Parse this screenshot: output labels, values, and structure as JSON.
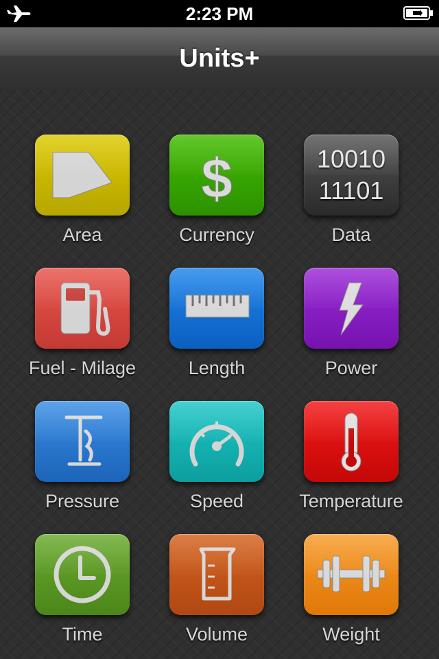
{
  "status_bar": {
    "time": "2:23 PM",
    "left_icon": "airplane-icon",
    "right_icon": "battery-charging-icon"
  },
  "nav": {
    "title": "Units+"
  },
  "tiles": [
    {
      "label": "Area",
      "color": "#c9b800",
      "icon": "area-shape-icon"
    },
    {
      "label": "Currency",
      "color": "#35a800",
      "icon": "dollar-icon"
    },
    {
      "label": "Data",
      "color": "#3c3c3c",
      "icon": "binary-data-icon",
      "data_lines": [
        "10010",
        "11101"
      ]
    },
    {
      "label": "Fuel - Milage",
      "color": "#d8403a",
      "icon": "fuel-pump-icon"
    },
    {
      "label": "Length",
      "color": "#1272d6",
      "icon": "ruler-icon"
    },
    {
      "label": "Power",
      "color": "#8a1ac8",
      "icon": "lightning-icon"
    },
    {
      "label": "Pressure",
      "color": "#2f80d8",
      "icon": "pump-icon"
    },
    {
      "label": "Speed",
      "color": "#13b8b8",
      "icon": "speedometer-icon"
    },
    {
      "label": "Temperature",
      "color": "#e21010",
      "icon": "thermometer-icon"
    },
    {
      "label": "Time",
      "color": "#5c9a24",
      "icon": "clock-icon"
    },
    {
      "label": "Volume",
      "color": "#c8561a",
      "icon": "beaker-icon"
    },
    {
      "label": "Weight",
      "color": "#f08a18",
      "icon": "dumbbell-icon"
    }
  ]
}
